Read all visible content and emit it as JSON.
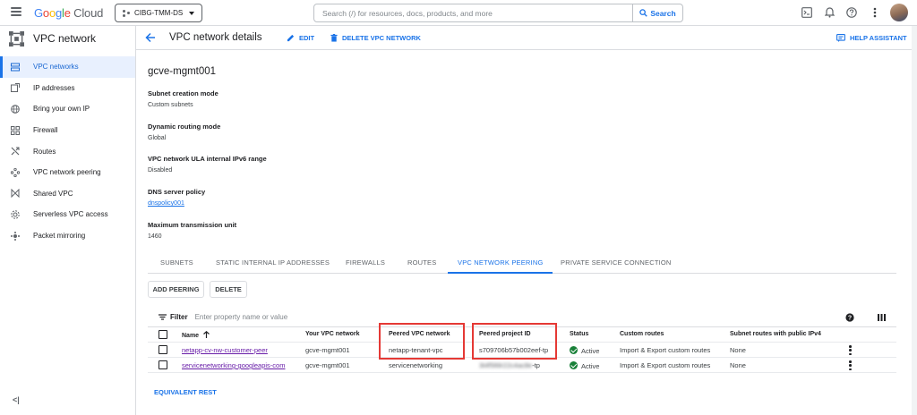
{
  "topbar": {
    "logo_letters": [
      "G",
      "o",
      "o",
      "g",
      "l",
      "e"
    ],
    "logo_cloud": "Cloud",
    "project": "CIBG-TMM-DS",
    "search_placeholder": "Search (/) for resources, docs, products, and more",
    "search_button": "Search",
    "icons": [
      "terminal-icon",
      "bell-icon",
      "help-icon",
      "more-vert-icon"
    ]
  },
  "sidebar": {
    "title": "VPC network",
    "items": [
      {
        "label": "VPC networks",
        "icon": "vpc-icon",
        "active": true
      },
      {
        "label": "IP addresses",
        "icon": "ip-icon",
        "active": false
      },
      {
        "label": "Bring your own IP",
        "icon": "globe-icon",
        "active": false
      },
      {
        "label": "Firewall",
        "icon": "firewall-icon",
        "active": false
      },
      {
        "label": "Routes",
        "icon": "routes-icon",
        "active": false
      },
      {
        "label": "VPC network peering",
        "icon": "peering-icon",
        "active": false
      },
      {
        "label": "Shared VPC",
        "icon": "shared-icon",
        "active": false
      },
      {
        "label": "Serverless VPC access",
        "icon": "serverless-icon",
        "active": false
      },
      {
        "label": "Packet mirroring",
        "icon": "mirror-icon",
        "active": false
      }
    ],
    "collapse": "<|"
  },
  "header": {
    "title": "VPC network details",
    "edit": "EDIT",
    "delete": "DELETE VPC NETWORK",
    "help": "HELP ASSISTANT"
  },
  "network": {
    "name": "gcve-mgmt001",
    "props": [
      {
        "label": "Subnet creation mode",
        "value": "Custom subnets",
        "link": false
      },
      {
        "label": "Dynamic routing mode",
        "value": "Global",
        "link": false
      },
      {
        "label": "VPC network ULA internal IPv6 range",
        "value": "Disabled",
        "link": false
      },
      {
        "label": "DNS server policy",
        "value": "dnspolicy001",
        "link": true
      },
      {
        "label": "Maximum transmission unit",
        "value": "1460",
        "link": false
      }
    ]
  },
  "tabs": [
    "SUBNETS",
    "STATIC INTERNAL IP ADDRESSES",
    "FIREWALLS",
    "ROUTES",
    "VPC NETWORK PEERING",
    "PRIVATE SERVICE CONNECTION"
  ],
  "active_tab": "VPC NETWORK PEERING",
  "actions": {
    "add": "ADD PEERING",
    "delete": "DELETE"
  },
  "filter": {
    "label": "Filter",
    "placeholder": "Enter property name or value"
  },
  "table": {
    "columns": [
      "Name",
      "Your VPC network",
      "Peered VPC network",
      "Peered project ID",
      "Status",
      "Custom routes",
      "Subnet routes with public IPv4"
    ],
    "rows": [
      {
        "name": "netapp-cv-nw-customer-peer",
        "your_vpc": "gcve-mgmt001",
        "peered_vpc": "netapp-tenant-vpc",
        "project_id": "s709706b57b002eef-tp",
        "status": "Active",
        "custom_routes": "Import & Export custom routes",
        "public_ipv4": "None"
      },
      {
        "name": "servicenetworking-googleapis-com",
        "your_vpc": "gcve-mgmt001",
        "peered_vpc": "servicenetworking",
        "project_id_hidden": "3t4f5l6lr22c4ac8e",
        "project_id_suffix": "-tp",
        "status": "Active",
        "custom_routes": "Import & Export custom routes",
        "public_ipv4": "None"
      }
    ]
  },
  "equivalent_rest": "EQUIVALENT REST"
}
